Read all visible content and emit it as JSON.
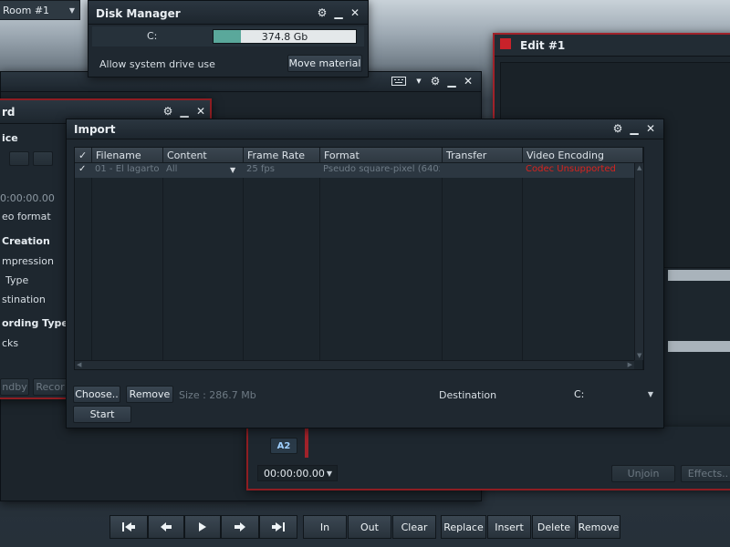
{
  "room_selector": {
    "label": "Room #1"
  },
  "disk_manager": {
    "title": "Disk Manager",
    "drive_label": "C:",
    "free_space": "374.8 Gb",
    "usage_fraction": 0.19,
    "allow_system_drive_label": "Allow system drive use",
    "move_material_button": "Move material"
  },
  "record_panel": {
    "title": "rd",
    "device_header": "ice",
    "timecode": "0:00:00.00",
    "video_format_label": "eo format",
    "creation_header": "Creation",
    "compression_label": "mpression",
    "type_label": "Type",
    "destination_label": "stination",
    "recording_type_header": "ording Type",
    "tracks_label": "cks",
    "standby_button": "ndby",
    "record_button": "Recor"
  },
  "edit_panel": {
    "title": "Edit #1",
    "track_label": "A2",
    "timecode": "00:00:00.00",
    "unjoin_button": "Unjoin",
    "effects_button": "Effects.."
  },
  "import_dialog": {
    "title": "Import",
    "columns": [
      "Filename",
      "Content",
      "Frame Rate",
      "Format",
      "Transfer",
      "Video Encoding"
    ],
    "check_header": "✓",
    "rows": [
      {
        "checked": "✓",
        "filename": "01 - El lagarto (",
        "content": "All",
        "frame_rate": "25 fps",
        "format": "Pseudo square-pixel (640x",
        "transfer": "",
        "video_encoding": "Codec Unsupported"
      }
    ],
    "choose_button": "Choose..",
    "remove_button": "Remove",
    "size_text": "Size : 286.7 Mb",
    "destination_label": "Destination",
    "destination_value": "C:",
    "start_button": "Start"
  },
  "transport": {
    "in_label": "In",
    "out_label": "Out",
    "clear_label": "Clear",
    "replace_label": "Replace",
    "insert_label": "Insert",
    "delete_label": "Delete",
    "remove_label": "Remove"
  },
  "colors": {
    "accent_red": "#c8222a",
    "disk_fill": "#5aa89b",
    "error_text": "#d8231e"
  }
}
